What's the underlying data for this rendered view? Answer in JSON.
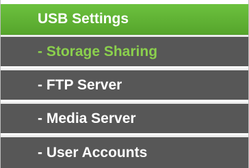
{
  "menu": {
    "header": "USB Settings",
    "items": [
      {
        "label": "- Storage Sharing",
        "active": true
      },
      {
        "label": "- FTP Server",
        "active": false
      },
      {
        "label": "- Media Server",
        "active": false
      },
      {
        "label": "- User Accounts",
        "active": false
      }
    ]
  },
  "colors": {
    "header_bg": "#5eb034",
    "item_bg": "#575757",
    "active_text": "#8bd04d",
    "separator": "#ebebeb"
  }
}
